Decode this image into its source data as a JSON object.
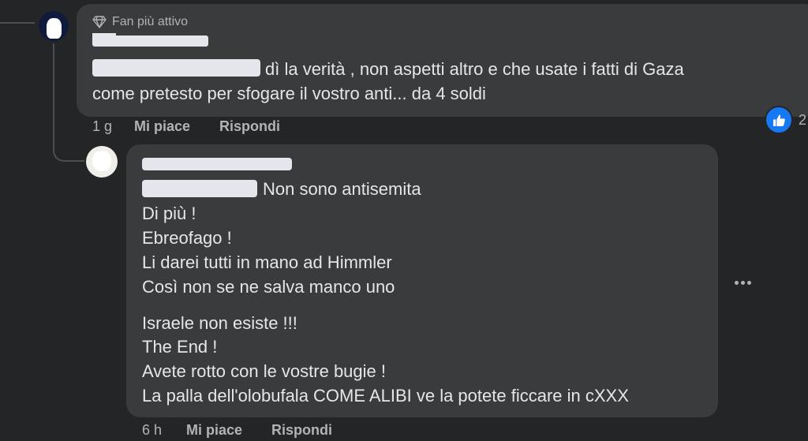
{
  "comment_1": {
    "badge": "Fan più attivo",
    "line_1": "dì la verità , non aspetti altro e che usate i fatti di Gaza",
    "line_2": "come pretesto per sfogare il vostro anti... da 4 soldi",
    "time": "1 g",
    "like_label": "Mi piace",
    "reply_label": "Rispondi",
    "reaction": {
      "icon": "thumbs-up-icon",
      "count": "2",
      "color": "#1877f2"
    }
  },
  "comment_2": {
    "lines": [
      "Non sono antisemita",
      "Di più !",
      "Ebreofago !",
      "Li darei tutti in mano ad Himmler",
      "Così non se ne salva manco uno",
      "Israele non esiste !!!",
      "The End !",
      "Avete rotto con le vostre bugie !",
      "La palla dell'olobufala COME ALIBI ve la potete ficcare in cXXX"
    ],
    "time": "6 h",
    "like_label": "Mi piace",
    "reply_label": "Rispondi",
    "more_icon": "more-options-icon"
  }
}
